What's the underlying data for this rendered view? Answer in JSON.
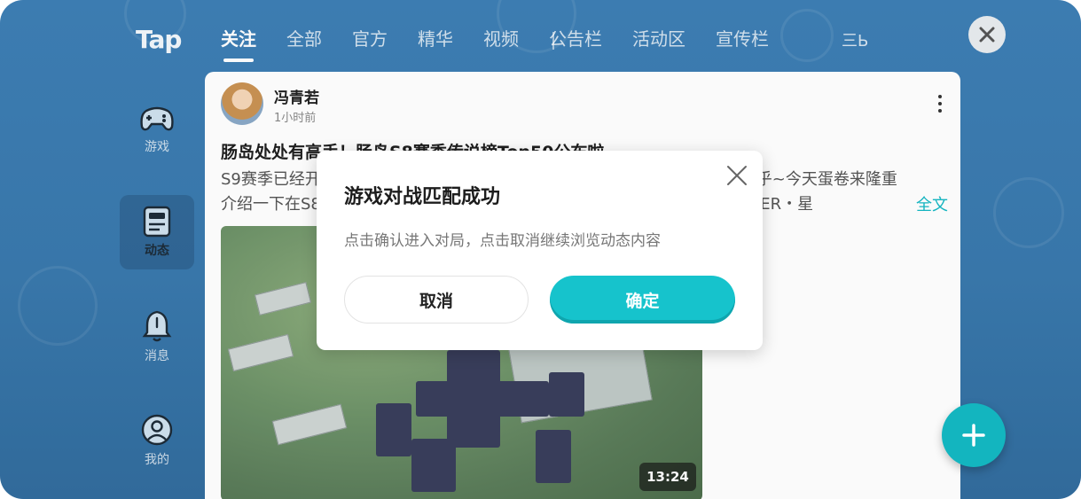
{
  "app": {
    "logo_text": "Tap"
  },
  "tabs": [
    {
      "label": "关注",
      "active": true
    },
    {
      "label": "全部",
      "active": false
    },
    {
      "label": "官方",
      "active": false
    },
    {
      "label": "精华",
      "active": false
    },
    {
      "label": "视频",
      "active": false
    },
    {
      "label": "公告栏",
      "active": false
    },
    {
      "label": "活动区",
      "active": false
    },
    {
      "label": "宣传栏",
      "active": false
    }
  ],
  "tab_more_label": "三Ь",
  "sidebar": {
    "items": [
      {
        "label": "游戏",
        "icon": "gamepad-icon",
        "active": false
      },
      {
        "label": "动态",
        "icon": "feed-icon",
        "active": true
      },
      {
        "label": "消息",
        "icon": "bell-icon",
        "active": false
      },
      {
        "label": "我的",
        "icon": "profile-icon",
        "active": false
      }
    ]
  },
  "post": {
    "author": "冯青若",
    "time": "1小时前",
    "title": "肠岛处处有高手！肠岛S8赛季传说榜Top50公布啦",
    "body_line1": "S9赛季已经开始了，S8赛季的传说榜也新鲜出炉，大家对榜单的讨论非常热乎~今天蛋卷来隆重",
    "body_line2": "介绍一下在S8赛季中冲上传说榜的玩家们，他们都经过了激烈的角逐，BETTER・星",
    "read_more": "全文",
    "video_duration": "13:24"
  },
  "dialog": {
    "title": "游戏对战匹配成功",
    "message": "点击确认进入对局，点击取消继续浏览动态内容",
    "cancel_label": "取消",
    "confirm_label": "确定"
  },
  "colors": {
    "accent": "#16c3cc",
    "background": "#3e7fb5"
  }
}
